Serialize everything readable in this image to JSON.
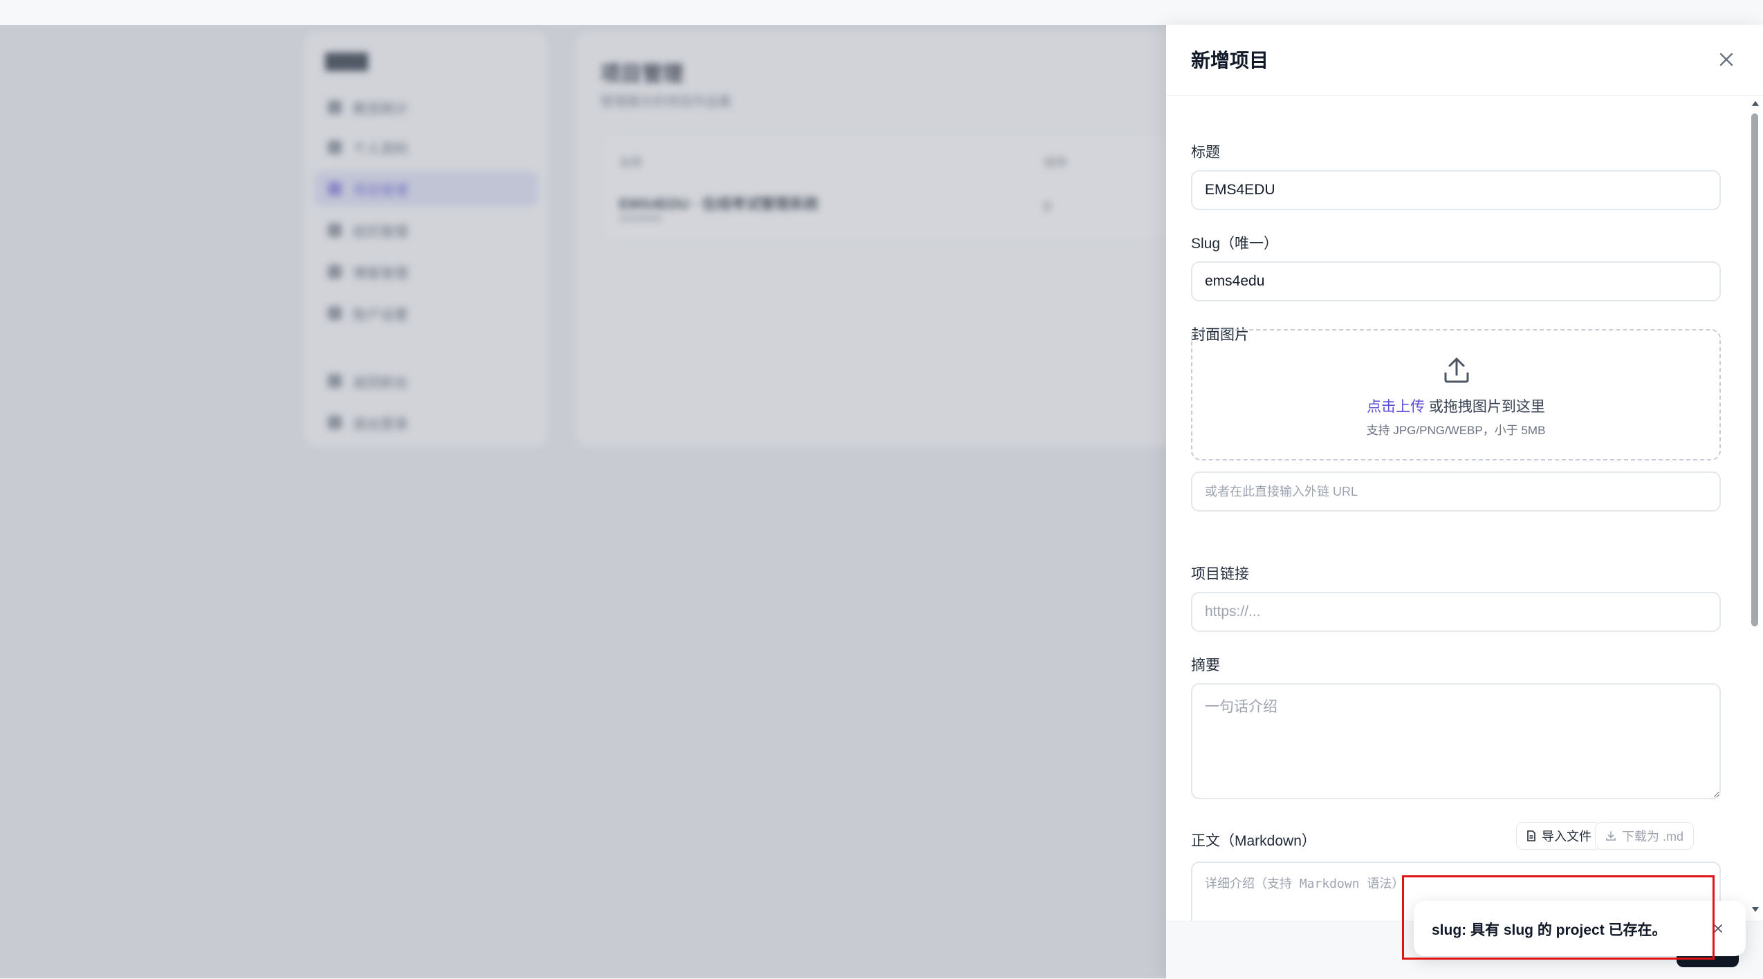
{
  "background": {
    "brand": "████",
    "nav": [
      "概览统计",
      "个人资料",
      "项目管理",
      "经历管理",
      "博客管理",
      "账户设置",
      "返回前台",
      "退出登录"
    ],
    "active_nav_index": 2,
    "page_title": "项目管理",
    "page_subtitle": "管理展示的项目作品集",
    "table_col_1": "名称",
    "table_col_2": "排序",
    "row_title": "EMS4EDU · 在线考试管理系统",
    "row_sub": "ems4edu",
    "row_order": "0"
  },
  "drawer": {
    "title": "新增项目",
    "fields": {
      "title_label": "标题",
      "title_value": "EMS4EDU",
      "slug_label": "Slug（唯一）",
      "slug_value": "ems4edu",
      "cover_label": "封面图片",
      "upload_link": "点击上传",
      "upload_text": " 或拖拽图片到这里",
      "upload_hint": "支持 JPG/PNG/WEBP，小于 5MB",
      "url_placeholder": "或者在此直接输入外链 URL",
      "link_label": "项目链接",
      "link_placeholder": "https://...",
      "summary_label": "摘要",
      "summary_placeholder": "一句话介绍",
      "body_label": "正文（Markdown）",
      "body_placeholder": "详细介绍（支持 Markdown 语法）",
      "import_button": "导入文件",
      "download_button": "下载为 .md"
    }
  },
  "toast": {
    "message": "slug: 具有 slug 的 project 已存在。"
  },
  "colors": {
    "accent": "#5b4fd6",
    "highlight": "#e01414",
    "primary_button": "#111827"
  },
  "icons": {
    "close": "close-icon",
    "upload": "upload-icon",
    "import": "file-icon",
    "download": "download-icon"
  }
}
